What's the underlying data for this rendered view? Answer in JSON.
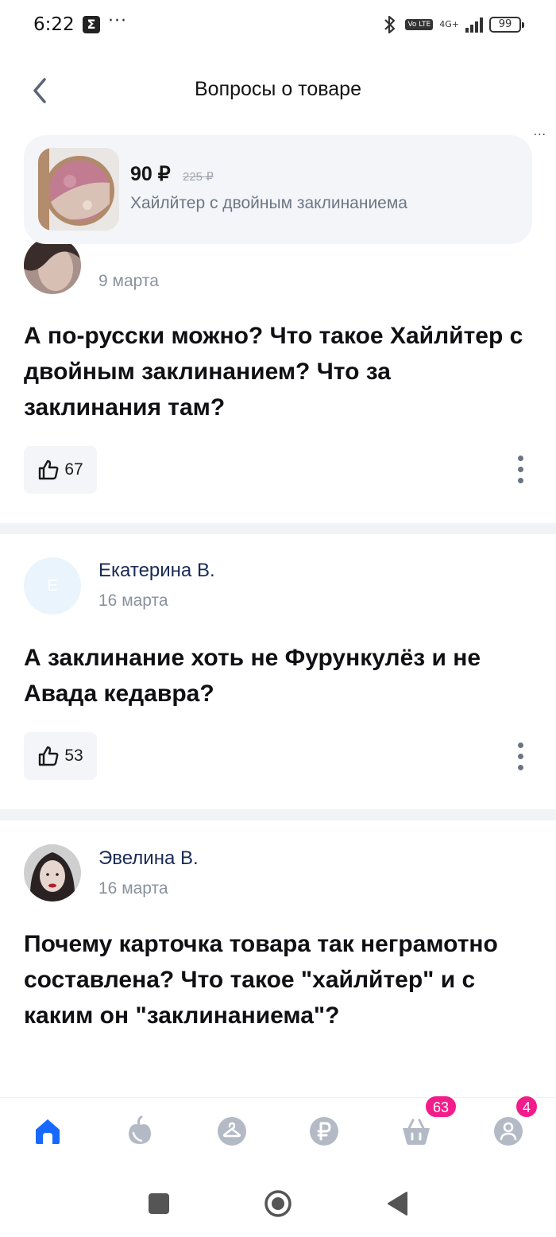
{
  "status_bar": {
    "time": "6:22",
    "sigma": "Σ",
    "dots": "···",
    "volte": "Vo LTE",
    "network": "4G+",
    "battery": "99"
  },
  "header": {
    "title": "Вопросы о товаре",
    "more": "..."
  },
  "product": {
    "price": "90 ₽",
    "old_price": "225 ₽",
    "name": "Хайлйтер с двойным заклинаниема"
  },
  "questions": [
    {
      "author": "",
      "date": "9 марта",
      "text": "А по-русски можно? Что такое Хайлйтер с двойным заклинанием? Что за заклинания там?",
      "likes": "67"
    },
    {
      "author": "Екатерина В.",
      "avatar_letter": "Е",
      "date": "16 марта",
      "text": "А заклинание хоть не Фурункулёз и не Авада кедавра?",
      "likes": "53"
    },
    {
      "author": "Эвелина В.",
      "date": "16 марта",
      "text": "Почему карточка товара так неграмотно составлена? Что такое \"хайлйтер\" и с каким он \"заклинаниема\"?",
      "likes": ""
    }
  ],
  "bottom_nav": {
    "items": [
      "home-icon",
      "catalog-icon",
      "hanger-icon",
      "ruble-icon",
      "cart-icon",
      "profile-icon"
    ],
    "cart_badge": "63",
    "profile_badge": "4",
    "active_color": "#1668ff",
    "inactive_color": "#b3bac6"
  },
  "colors": {
    "badge": "#f21c8a",
    "author": "#1a2a55",
    "card_bg": "#f3f5f8"
  }
}
